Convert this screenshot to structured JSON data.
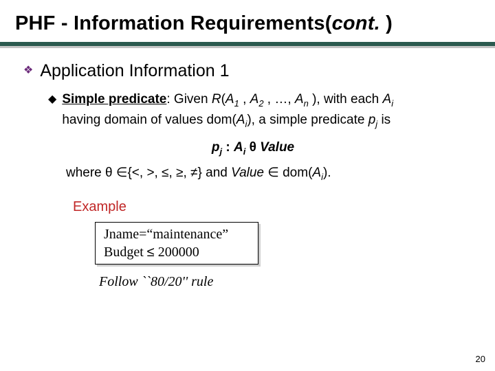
{
  "title": {
    "main": "PHF - Information Requirements(",
    "cont": "cont.",
    "tail": " )"
  },
  "lvl1": {
    "text": "Application Information 1"
  },
  "lvl2": {
    "label_bold": "Simple predicate",
    "after_colon": ": Given ",
    "R": "R",
    "open": "(",
    "A": "A",
    "s1": "1",
    "comma": " , ",
    "s2": "2",
    "dots": " , …, ",
    "sn": "n",
    "close": " ), with each ",
    "si": "i",
    "line2a": "having domain of values dom(",
    "line2b": "), a simple predicate ",
    "p": "p",
    "sj": "j",
    "is": " is"
  },
  "formula": {
    "p": "p",
    "sj": "j",
    "colon": " :    ",
    "A": "A",
    "si": "i",
    "theta": " θ ",
    "value": "Value"
  },
  "where": {
    "pre": "where ",
    "theta": "θ ",
    "inset": "∈",
    "set": "{<, >, ≤, ≥, ≠} and ",
    "value": "Value",
    "in2": " ∈ dom(",
    "A": "A",
    "si": "i",
    "tail": ")."
  },
  "example": {
    "label": "Example",
    "line1": "Jname=“maintenance”",
    "line2_a": "Budget ",
    "line2_op": "≤",
    "line2_b": " 200000"
  },
  "follow": "Follow ``80/20'' rule",
  "pagenum": "20"
}
